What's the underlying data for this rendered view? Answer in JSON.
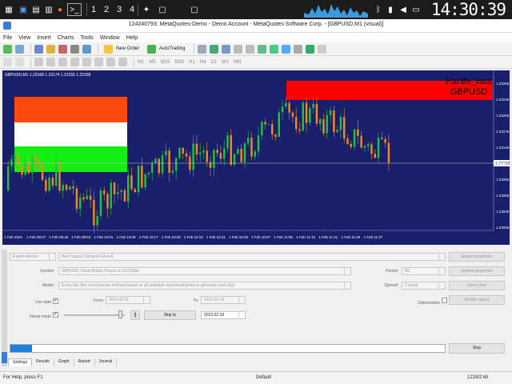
{
  "taskbar": {
    "desktops": [
      "1",
      "2",
      "3",
      "4"
    ],
    "clock": "14:30:39"
  },
  "window": {
    "title": "124240793: MetaQuotes-Demo - Demo Account - MetaQuotes Software Corp. - [GBPUSD,M1 (visual)]"
  },
  "menu": [
    "File",
    "View",
    "Insert",
    "Charts",
    "Tools",
    "Window",
    "Help"
  ],
  "toolbar": {
    "new_order": "New Order",
    "auto_trading": "AutoTrading",
    "timeframes": [
      "M1",
      "M5",
      "M15",
      "M30",
      "H1",
      "H4",
      "D1",
      "W1",
      "MN"
    ]
  },
  "chart": {
    "symbol_line": "GBPUSD,M1  1.23168 1.23174 1.23155 1.23158",
    "watermark_line1": "Hanife_Issa",
    "watermark_line2": "GBPUSD",
    "current_price": "1.23158",
    "colors": {
      "background": "#1a1f6b",
      "bull": "#22c33a",
      "bear": "#f08c1e",
      "flag_orange": "#ff4a0f",
      "flag_white": "#ffffff",
      "flag_green": "#13ee13",
      "red_zone": "#ff0000"
    },
    "price_ticks": [
      "1.23265",
      "1.23235",
      "1.23205",
      "1.23175",
      "1.23145",
      "1.23125",
      "1.23095",
      "1.23065",
      "1.23035",
      "1.23005"
    ],
    "time_ticks": [
      "1 Feb 2023",
      "1 Feb 09:37",
      "1 Feb 09:45",
      "1 Feb 09:53",
      "1 Feb 10:01",
      "1 Feb 10:09",
      "1 Feb 10:17",
      "1 Feb 10:25",
      "1 Feb 10:33",
      "1 Feb 10:41",
      "1 Feb 10:49",
      "1 Feb 10:57",
      "1 Feb 11:05",
      "1 Feb 11:13",
      "1 Feb 11:21",
      "1 Feb 11:29",
      "1 Feb 11:37"
    ]
  },
  "tester": {
    "type_label": "Expert Advisor",
    "expert_value": "Best Supply Demand EA.ex4",
    "symbol_label": "Symbol:",
    "symbol_value": "GBPUSD, Great Britain Pound vs US Dollar",
    "model_label": "Model:",
    "model_value": "Every tick (the most precise method based on all available least timeframes to generate each tick)",
    "use_date_label": "Use date",
    "from_label": "From:",
    "from_value": "2023.02.01",
    "to_label": "To:",
    "to_value": "2023.02.18",
    "visual_label": "Visual mode",
    "skip_label": "Skip to",
    "skip_value": "2023.02.18",
    "period_label": "Period:",
    "period_value": "M1",
    "spread_label": "Spread:",
    "spread_value": "Current",
    "optimization_label": "Optimization",
    "buttons": {
      "expert_properties": "Expert properties",
      "symbol_properties": "Symbol properties",
      "open_chart": "Open chart",
      "modify_expert": "Modify expert",
      "stop": "Stop"
    },
    "progress": 0.05,
    "tabs": [
      "Settings",
      "Results",
      "Graph",
      "Report",
      "Journal"
    ]
  },
  "status": {
    "help": "For Help, press F1",
    "profile": "Default",
    "traffic": "1219/2 kb"
  }
}
